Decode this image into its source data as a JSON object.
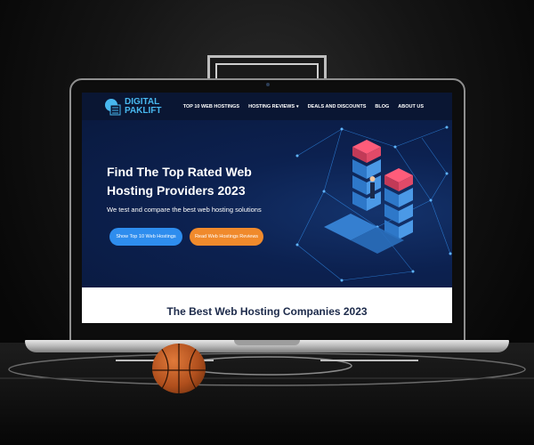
{
  "site": {
    "logo": {
      "line1": "DIGITAL",
      "line2": "PAKLIFT",
      "accent": "#48b8ef"
    },
    "nav": {
      "items": [
        {
          "label": "TOP 10 WEB HOSTINGS"
        },
        {
          "label": "HOSTING REVIEWS",
          "has_dropdown": true
        },
        {
          "label": "DEALS AND DISCOUNTS"
        },
        {
          "label": "BLOG"
        },
        {
          "label": "ABOUT US"
        }
      ]
    },
    "hero": {
      "title": "Find The Top Rated Web Hosting Providers 2023",
      "subtitle": "We test and compare the best web hosting solutions",
      "primary_button": "Show Top 10 Web Hostings",
      "secondary_button": "Read Web Hostings Reviews",
      "illustration_icon": "server-stack-network-icon"
    },
    "section": {
      "title": "The Best Web Hosting Companies 2023"
    }
  },
  "colors": {
    "header_bg": "#0a1633",
    "hero_bg": "#0c2150",
    "primary_button": "#2e8dee",
    "secondary_button": "#f08a2c",
    "section_title": "#1c2a4a"
  },
  "scene": {
    "device_icon": "laptop-icon",
    "props": [
      "basketball-icon",
      "backboard-icon"
    ]
  }
}
